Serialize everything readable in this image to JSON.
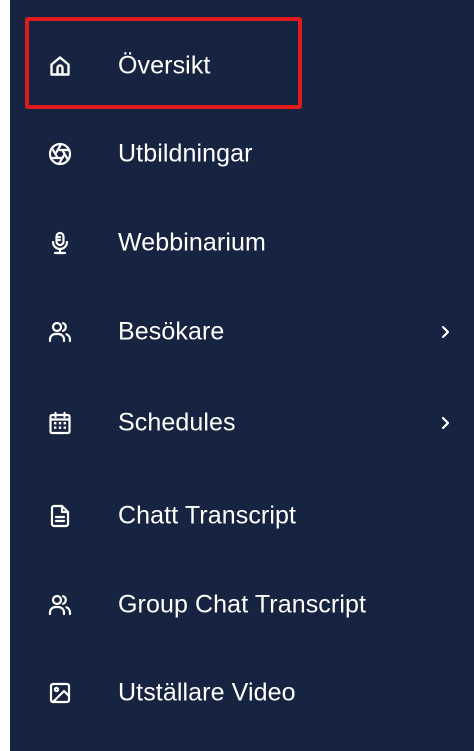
{
  "sidebar": {
    "items": [
      {
        "label": "Översikt",
        "icon": "home-icon",
        "active": true
      },
      {
        "label": "Utbildningar",
        "icon": "aperture-icon"
      },
      {
        "label": "Webbinarium",
        "icon": "microphone-icon"
      },
      {
        "label": "Besökare",
        "icon": "users-icon",
        "has_submenu": true
      },
      {
        "label": "Schedules",
        "icon": "calendar-icon",
        "has_submenu": true
      },
      {
        "label": "Chatt Transcript",
        "icon": "file-text-icon"
      },
      {
        "label": "Group Chat Transcript",
        "icon": "users-icon"
      },
      {
        "label": "Utställare Video",
        "icon": "image-icon"
      }
    ],
    "colors": {
      "background": "#172441",
      "text": "#ffffff",
      "highlight": "#e01b1b"
    }
  }
}
